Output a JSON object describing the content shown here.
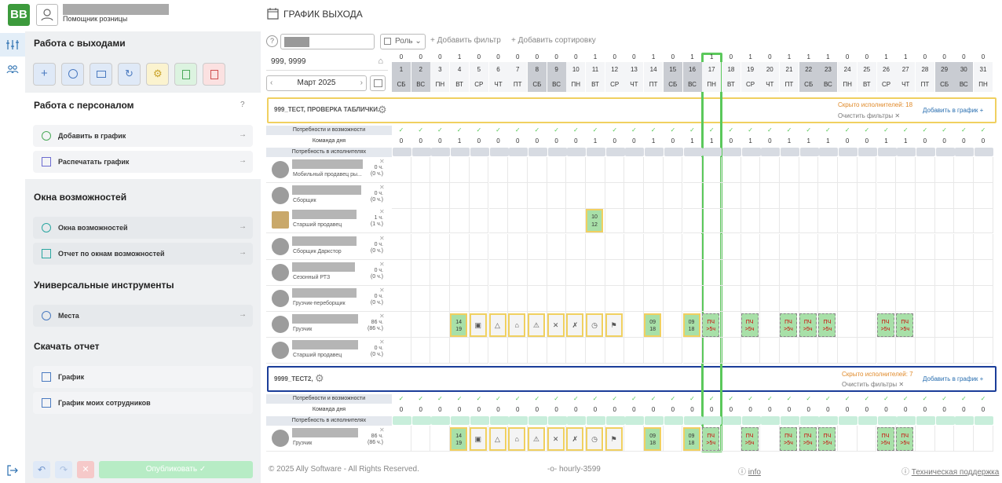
{
  "app": {
    "logo": "ВВ",
    "user_role": "Помощник розницы",
    "page_title": "ГРАФИК ВЫХОДА"
  },
  "sidebar": {
    "sections": [
      {
        "title": "Работа с выходами"
      },
      {
        "title": "Работа с персоналом"
      },
      {
        "title": "Окна возможностей"
      },
      {
        "title": "Универсальные инструменты"
      },
      {
        "title": "Скачать отчет"
      }
    ],
    "items": {
      "add_to_schedule": "Добавить в график",
      "print_schedule": "Распечатать график",
      "windows": "Окна возможностей",
      "windows_report": "Отчет по окнам возможностей",
      "places": "Места",
      "schedule": "График",
      "my_employees_schedule": "График моих сотрудников"
    },
    "publish_label": "Опубликовать"
  },
  "toolbar": {
    "role_label": "Роль",
    "add_filter": "Добавить фильтр",
    "add_sort": "Добавить сортировку",
    "store": "999, 9999",
    "month": "Март 2025"
  },
  "days": {
    "numbers": [
      "1",
      "2",
      "3",
      "4",
      "5",
      "6",
      "7",
      "8",
      "9",
      "10",
      "11",
      "12",
      "13",
      "14",
      "15",
      "16",
      "17",
      "18",
      "19",
      "20",
      "21",
      "22",
      "23",
      "24",
      "25",
      "26",
      "27",
      "28",
      "29",
      "30",
      "31"
    ],
    "weekdays": [
      "СБ",
      "ВС",
      "ПН",
      "ВТ",
      "СР",
      "ЧТ",
      "ПТ",
      "СБ",
      "ВС",
      "ПН",
      "ВТ",
      "СР",
      "ЧТ",
      "ПТ",
      "СБ",
      "ВС",
      "ПН",
      "ВТ",
      "СР",
      "ЧТ",
      "ПТ",
      "СБ",
      "ВС",
      "ПН",
      "ВТ",
      "СР",
      "ЧТ",
      "ПТ",
      "СБ",
      "ВС",
      "ПН"
    ],
    "top_counts": [
      "0",
      "0",
      "0",
      "1",
      "0",
      "0",
      "0",
      "0",
      "0",
      "0",
      "1",
      "0",
      "0",
      "1",
      "0",
      "1",
      "1",
      "0",
      "1",
      "0",
      "1",
      "1",
      "1",
      "0",
      "0",
      "1",
      "1",
      "0",
      "0",
      "0",
      "0"
    ]
  },
  "groups": [
    {
      "title": "999_ТЕСТ, ПРОВЕРКА ТАБЛИЧКИ.",
      "hidden": "Скрыто исполнителей: 18",
      "clear": "Очистить фильтры",
      "add": "Добавить в график"
    },
    {
      "title": "9999_ТЕСТ2,",
      "hidden": "Скрыто исполнителей: 7",
      "clear": "Очистить фильтры",
      "add": "Добавить в график"
    }
  ],
  "need_labels": {
    "needs": "Потребности и возможности",
    "team": "Команда дня",
    "need_exec": "Потребность в исполнителях"
  },
  "employees": [
    {
      "role": "Мобильный продавец ры...",
      "hours": "0 ч.",
      "hours2": "(0 ч.)"
    },
    {
      "role": "Сборщик",
      "hours": "0 ч.",
      "hours2": "(0 ч.)"
    },
    {
      "role": "Старший продавец",
      "hours": "1 ч.",
      "hours2": "(1 ч.)"
    },
    {
      "role": "Сборщик Даркстор",
      "hours": "0 ч.",
      "hours2": "(0 ч.)"
    },
    {
      "role": "Сезонный РТЗ",
      "hours": "0 ч.",
      "hours2": "(0 ч.)"
    },
    {
      "role": "Грузчик-переборщик",
      "hours": "0 ч.",
      "hours2": "(0 ч.)"
    },
    {
      "role": "Грузчик",
      "hours": "86 ч.",
      "hours2": "(86 ч.)"
    },
    {
      "role": "Старший продавец",
      "hours": "0 ч.",
      "hours2": "(0 ч.)"
    },
    {
      "role": "Грузчик",
      "hours": "86 ч.",
      "hours2": "(86 ч.)"
    }
  ],
  "shift": {
    "a_start": "14",
    "a_end": "19",
    "b_start": "09",
    "b_end": "18",
    "sp_start": "10",
    "sp_end": "12",
    "pch": "ПЧ",
    "pch2": ">5ч"
  },
  "footer": {
    "copyright": "© 2025 Ally Software - All Rights Reserved.",
    "build": "-o- hourly-3599",
    "info": "info",
    "support": "Техническая поддержка"
  },
  "colors": {
    "accent_green": "#3c9a3c",
    "highlight": "#5bc85b",
    "yellow_border": "#f0d060",
    "blue_border": "#1b3d99"
  }
}
